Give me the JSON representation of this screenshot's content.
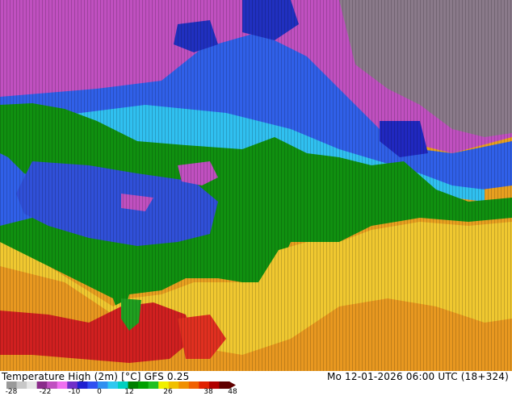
{
  "map": {
    "title": "Temperature High (2m) [°C] GFS 0.25",
    "datetime": "Mo 12-01-2026 06:00 UTC (18+324)"
  },
  "legend": {
    "ticks": [
      "-28",
      "-22",
      "-10",
      "0",
      "12",
      "26",
      "38",
      "48"
    ],
    "colors": [
      "#9a9a9a",
      "#c8c8c8",
      "#e6e6e6",
      "#8a2c8a",
      "#c050c0",
      "#f070f0",
      "#7030c8",
      "#2020d0",
      "#3050f0",
      "#3090f0",
      "#30c8f0",
      "#00d0c0",
      "#008000",
      "#00a000",
      "#20c020",
      "#f0f000",
      "#f0c000",
      "#f09000",
      "#f06000",
      "#e02000",
      "#b00000",
      "#600000"
    ]
  }
}
